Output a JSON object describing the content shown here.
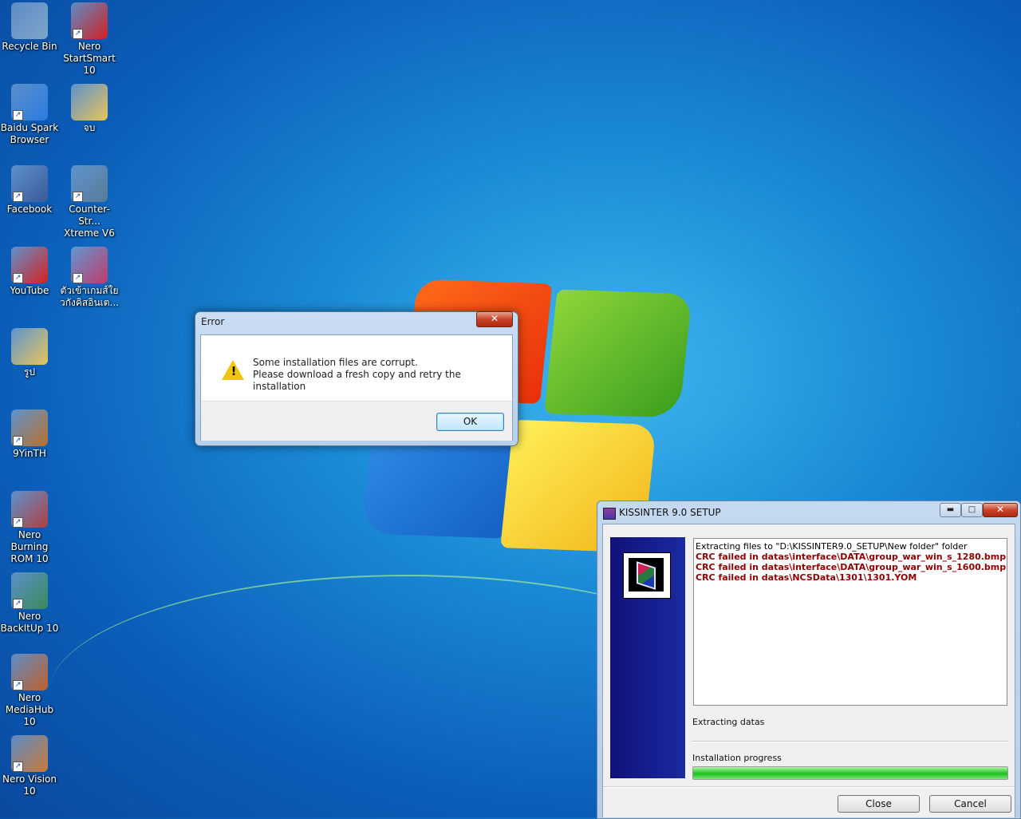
{
  "desktop": {
    "icons": [
      {
        "label": "Recycle Bin",
        "icon": "recycle-bin-icon",
        "color": "#7fa6c8"
      },
      {
        "label": "Nero StartSmart 10",
        "icon": "nero-startsmart-icon",
        "color": "#d22020"
      },
      {
        "label": "Baidu Spark Browser",
        "icon": "baidu-spark-icon",
        "color": "#2b7be0"
      },
      {
        "label": "จบ",
        "icon": "folder-icon",
        "color": "#e8c45a"
      },
      {
        "label": "Facebook",
        "icon": "facebook-icon",
        "color": "#3b5998"
      },
      {
        "label": "Counter-Str... Xtreme V6",
        "icon": "counter-strike-icon",
        "color": "#5a7a96"
      },
      {
        "label": "YouTube",
        "icon": "youtube-icon",
        "color": "#d8201e"
      },
      {
        "label": "ตัวเข้าเกมส์ใย วกังคิสอินเต...",
        "icon": "game-launcher-icon",
        "color": "#c03a6a"
      },
      {
        "label": "รูป",
        "icon": "folder-icon",
        "color": "#e8c45a"
      },
      {
        "label": "9YinTH",
        "icon": "9yin-icon",
        "color": "#b8702a"
      },
      {
        "label": "Nero Burning ROM 10",
        "icon": "nero-burning-rom-icon",
        "color": "#b04040"
      },
      {
        "label": "Nero BackItUp 10",
        "icon": "nero-backitup-icon",
        "color": "#3a8a5a"
      },
      {
        "label": "Nero MediaHub 10",
        "icon": "nero-mediahub-icon",
        "color": "#c0602a"
      },
      {
        "label": "Nero Vision 10",
        "icon": "nero-vision-icon",
        "color": "#c77a3a"
      }
    ]
  },
  "error_dialog": {
    "title": "Error",
    "close": "✕",
    "message_line1": "Some installation files are corrupt.",
    "message_line2": "Please download a fresh copy and retry the installation",
    "ok_label": "OK"
  },
  "setup_window": {
    "title": "KISSINTER 9.0 SETUP",
    "minimize": "▬",
    "maximize": "□",
    "close": "✕",
    "log_lines": [
      "Extracting files to \"D:\\KISSINTER9.0_SETUP\\New folder\" folder",
      "CRC failed in datas\\interface\\DATA\\group_war_win_s_1280.bmp",
      "CRC failed in datas\\interface\\DATA\\group_war_win_s_1600.bmp",
      "CRC failed in datas\\NCSData\\1301\\1301.YOM"
    ],
    "status": "Extracting datas",
    "progress_label": "Installation progress",
    "progress": 1.0,
    "close_button": "Close",
    "cancel_button": "Cancel"
  }
}
